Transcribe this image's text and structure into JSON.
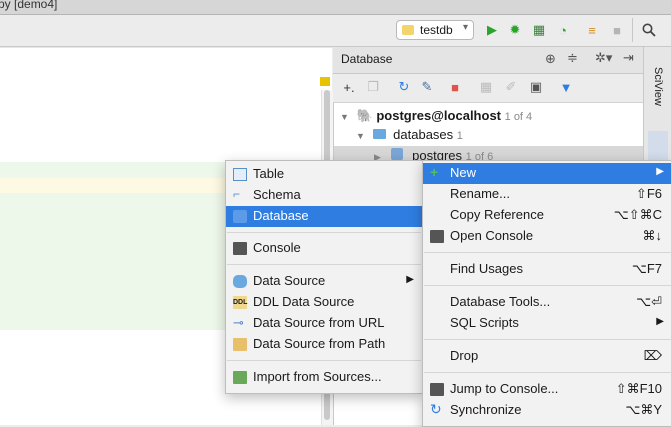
{
  "window": {
    "title": "py [demo4]"
  },
  "toolbar": {
    "db_select": "testdb",
    "icons": [
      "run-icon",
      "debug-icon",
      "coverage-icon",
      "profile-icon",
      "concurrency-icon",
      "stop-icon",
      "search-icon"
    ]
  },
  "db_panel": {
    "title": "Database",
    "tree": {
      "root_label": "postgres@localhost",
      "root_count": "1 of 4",
      "databases_label": "databases",
      "databases_count": "1",
      "postgres_label": "postgres",
      "postgres_count": "1 of 6"
    }
  },
  "side_tab": {
    "sciview": "SciView"
  },
  "submenu_new": {
    "items": [
      {
        "label": "Table"
      },
      {
        "label": "Schema"
      },
      {
        "label": "Database"
      },
      {
        "label": "Console"
      },
      {
        "label": "Data Source"
      },
      {
        "label": "DDL Data Source"
      },
      {
        "label": "Data Source from URL"
      },
      {
        "label": "Data Source from Path"
      },
      {
        "label": "Import from Sources..."
      }
    ]
  },
  "context_menu": {
    "items": [
      {
        "label": "New"
      },
      {
        "label": "Rename...",
        "shortcut": "⇧F6"
      },
      {
        "label": "Copy Reference",
        "shortcut": "⌥⇧⌘C"
      },
      {
        "label": "Open Console",
        "shortcut": "⌘↓"
      },
      {
        "label": "Find Usages",
        "shortcut": "⌥F7"
      },
      {
        "label": "Database Tools...",
        "shortcut": "⌥⏎"
      },
      {
        "label": "SQL Scripts"
      },
      {
        "label": "Drop",
        "shortcut": "⌦"
      },
      {
        "label": "Jump to Console...",
        "shortcut": "⇧⌘F10"
      },
      {
        "label": "Synchronize",
        "shortcut": "⌥⌘Y"
      }
    ]
  }
}
